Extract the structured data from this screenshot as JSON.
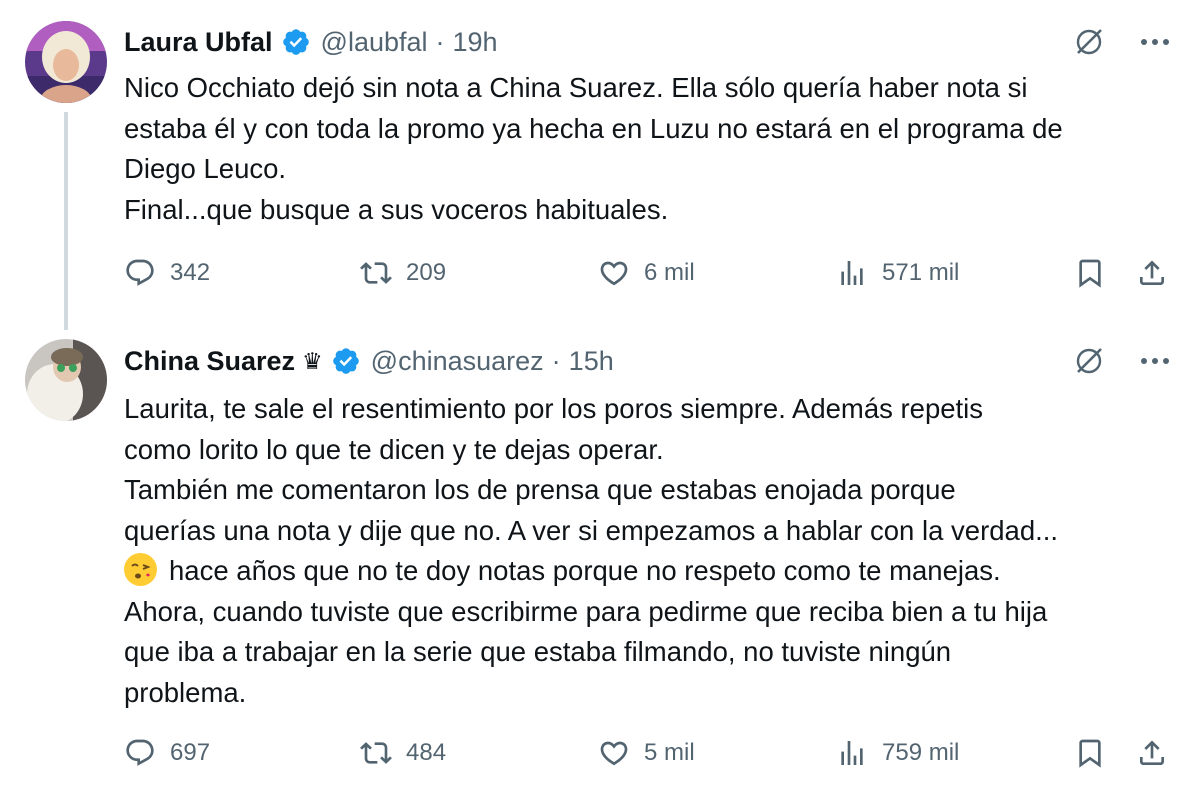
{
  "tweets": [
    {
      "name": "Laura Ubfal",
      "crown": "",
      "handle": "@laubfal",
      "separator": "·",
      "time": "19h",
      "lines": [
        "Nico Occhiato dejó sin nota a China Suarez. Ella sólo quería haber nota si",
        "estaba él y con toda la promo ya hecha en Luzu no estará en el programa de",
        "Diego Leuco.",
        "Final...que busque a sus voceros habituales."
      ],
      "replies": "342",
      "reposts": "209",
      "likes": "6 mil",
      "views": "571 mil"
    },
    {
      "name": "China Suarez",
      "crown": "♛",
      "handle": "@chinasuarez",
      "separator": "·",
      "time": "15h",
      "lines": [
        "Laurita, te sale el resentimiento por los poros siempre. Además repetis",
        "como lorito lo que te dicen y te dejas operar.",
        "También me comentaron los de prensa que estabas enojada porque",
        "querías una nota y dije que no. A ver si empezamos a hablar con la verdad...",
        "hace años que no te doy notas porque no respeto como te manejas.",
        "Ahora, cuando tuviste que escribirme para pedirme que reciba bien a tu hija",
        "que iba a trabajar en la serie que estaba filmando, no tuviste ningún",
        "problema."
      ],
      "replies": "697",
      "reposts": "484",
      "likes": "5 mil",
      "views": "759 mil"
    }
  ],
  "colors": {
    "verified": "#1d9bf0",
    "secondary_text": "#536471",
    "thread_line": "#cfd9de"
  },
  "icons": [
    "verified-badge-icon",
    "grok-icon",
    "more-icon",
    "reply-icon",
    "repost-icon",
    "like-icon",
    "views-icon",
    "bookmark-icon",
    "share-icon",
    "kiss-emoji-icon"
  ]
}
